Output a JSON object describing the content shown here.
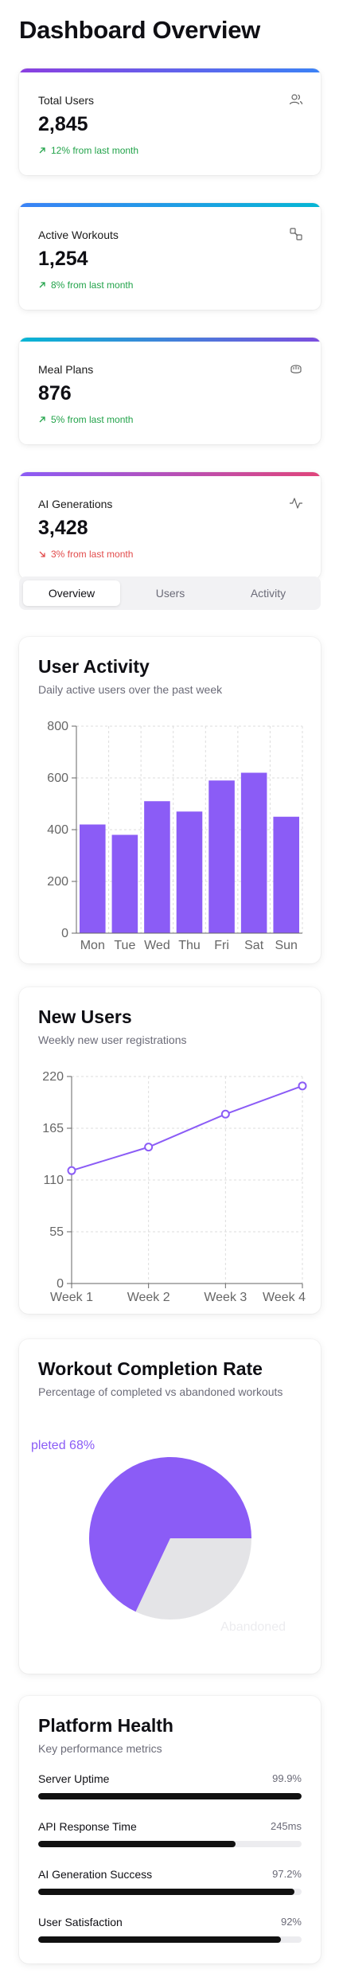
{
  "page": {
    "title": "Dashboard Overview"
  },
  "stats": [
    {
      "label": "Total Users",
      "value": "2,845",
      "change": "12% from last month",
      "trend": "up",
      "icon": "users-icon",
      "gradient": [
        "#8b3fe0",
        "#3b82f6"
      ]
    },
    {
      "label": "Active Workouts",
      "value": "1,254",
      "change": "8% from last month",
      "trend": "up",
      "icon": "dumbbell-icon",
      "gradient": [
        "#3b82f6",
        "#06b6d4"
      ]
    },
    {
      "label": "Meal Plans",
      "value": "876",
      "change": "5% from last month",
      "trend": "up",
      "icon": "meal-icon",
      "gradient": [
        "#06b6d4",
        "#7c4ddf"
      ]
    },
    {
      "label": "AI Generations",
      "value": "3,428",
      "change": "3% from last month",
      "trend": "down",
      "icon": "activity-icon",
      "gradient": [
        "#8b5cf6",
        "#e0457b"
      ]
    }
  ],
  "tabs": [
    {
      "label": "Overview",
      "active": true
    },
    {
      "label": "Users",
      "active": false
    },
    {
      "label": "Activity",
      "active": false
    }
  ],
  "user_activity": {
    "title": "User Activity",
    "subtitle": "Daily active users over the past week"
  },
  "new_users": {
    "title": "New Users",
    "subtitle": "Weekly new user registrations"
  },
  "workout_completion": {
    "title": "Workout Completion Rate",
    "subtitle": "Percentage of completed vs abandoned workouts",
    "completed_label": "pleted 68%",
    "abandoned_label": "Abandoned"
  },
  "platform_health": {
    "title": "Platform Health",
    "subtitle": "Key performance metrics",
    "metrics": [
      {
        "label": "Server Uptime",
        "value": "99.9%",
        "level": 0.999
      },
      {
        "label": "API Response Time",
        "value": "245ms",
        "level": 0.75
      },
      {
        "label": "AI Generation Success",
        "value": "97.2%",
        "level": 0.972
      },
      {
        "label": "User Satisfaction",
        "value": "92%",
        "level": 0.92
      }
    ]
  },
  "colors": {
    "accent": "#8b5cf6",
    "up": "#22a34a",
    "down": "#e24b4b",
    "abandoned": "#e4e4e7"
  },
  "chart_data": [
    {
      "type": "bar",
      "categories": [
        "Mon",
        "Tue",
        "Wed",
        "Thu",
        "Fri",
        "Sat",
        "Sun"
      ],
      "values": [
        420,
        380,
        510,
        470,
        590,
        620,
        450
      ],
      "ylim": [
        0,
        800
      ],
      "yticks": [
        "0",
        "200",
        "400",
        "600",
        "800"
      ],
      "grid": true
    },
    {
      "type": "line",
      "categories": [
        "Week 1",
        "",
        "Week 2",
        "",
        "Week 3",
        "Week 4"
      ],
      "x": [
        "Week 1",
        "Week 2",
        "Week 3",
        "Week 4"
      ],
      "values": [
        120,
        145,
        180,
        210
      ],
      "ylim": [
        0,
        220
      ],
      "yticks": [
        "0",
        "55",
        "110",
        "165",
        "220"
      ],
      "grid": true
    },
    {
      "type": "pie",
      "slices": [
        {
          "name": "Completed",
          "value": 68
        },
        {
          "name": "Abandoned",
          "value": 32
        }
      ]
    }
  ]
}
